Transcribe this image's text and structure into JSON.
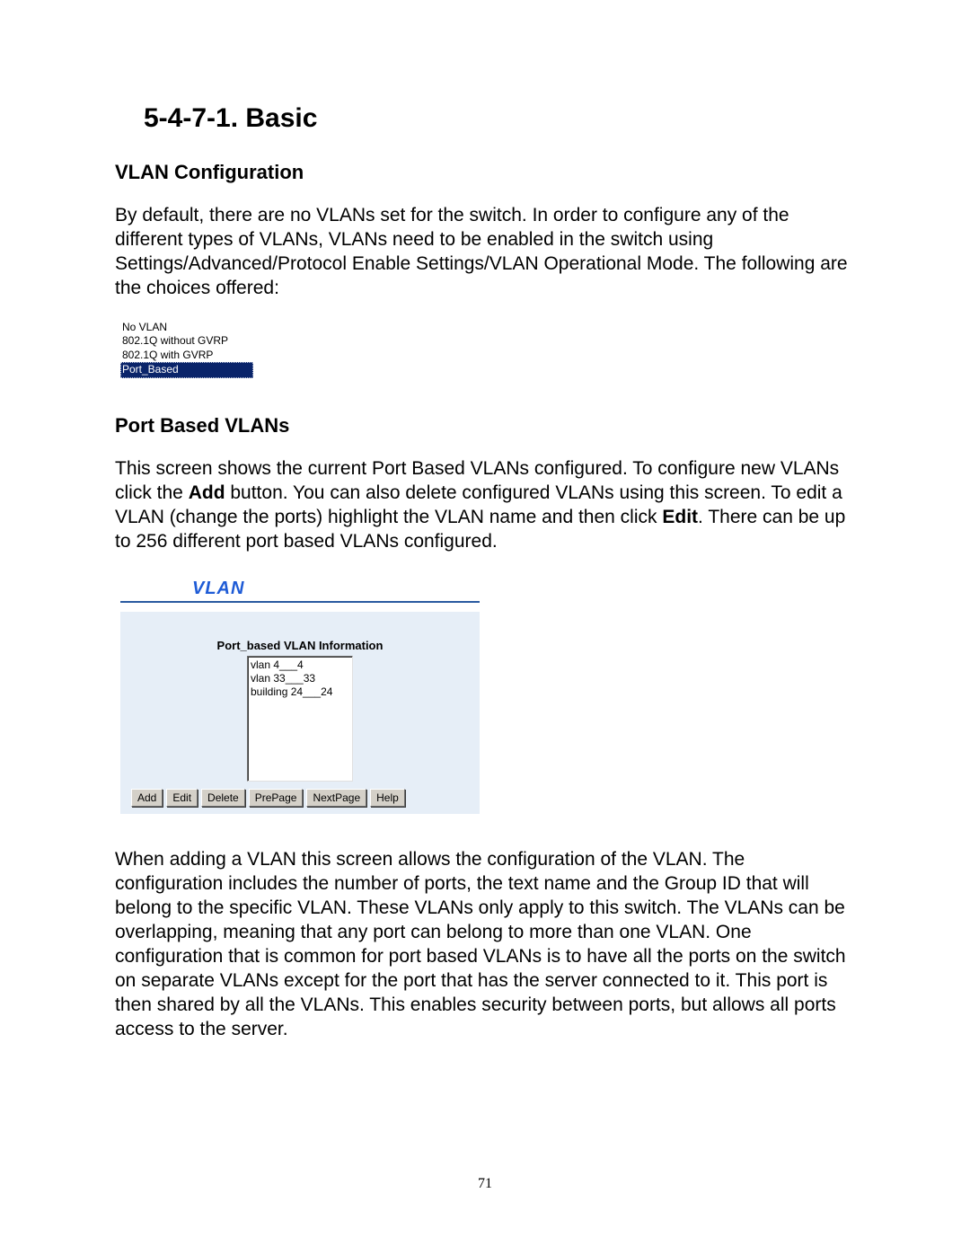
{
  "section_title": "5-4-7-1. Basic",
  "sub1": "VLAN Configuration",
  "para1": "By default, there are no VLANs set for the switch.  In order to configure any of the different types of VLANs, VLANs need to be enabled in the switch using Settings/Advanced/Protocol Enable Settings/VLAN Operational Mode.  The following are the choices offered:",
  "options": {
    "o1": "No VLAN",
    "o2": "802.1Q without GVRP",
    "o3": "802.1Q with GVRP",
    "o4": "Port_Based"
  },
  "sub2": "Port Based VLANs",
  "para2_a": "This screen shows the current Port Based VLANs configured.  To configure new VLANs click the ",
  "para2_add": "Add",
  "para2_b": " button.  You can also delete configured VLANs using this screen.  To edit a VLAN (change the ports) highlight the VLAN name and then click ",
  "para2_edit": "Edit",
  "para2_c": ".  There can be up to 256 different port based VLANs configured.",
  "gui": {
    "title": "VLAN",
    "panel_title": "Port_based VLAN Information",
    "list": {
      "r1": "vlan 4___4",
      "r2": "vlan 33___33",
      "r3": "building 24___24"
    },
    "buttons": {
      "add": "Add",
      "edit": "Edit",
      "delete": "Delete",
      "prepage": "PrePage",
      "nextpage": "NextPage",
      "help": "Help"
    }
  },
  "para3": "When adding a VLAN this screen allows the configuration of the VLAN.  The configuration includes the number of ports, the text name and the Group ID that will belong to the specific VLAN.  These VLANs only apply to this switch.  The VLANs can be overlapping, meaning that any port can belong to more than one VLAN.  One configuration that is common for port based VLANs is to have all the ports on the switch on separate VLANs except for the port that has the server connected to it.  This port is then shared by all the VLANs.  This enables security between ports, but allows all ports access to the server.",
  "page_number": "71"
}
